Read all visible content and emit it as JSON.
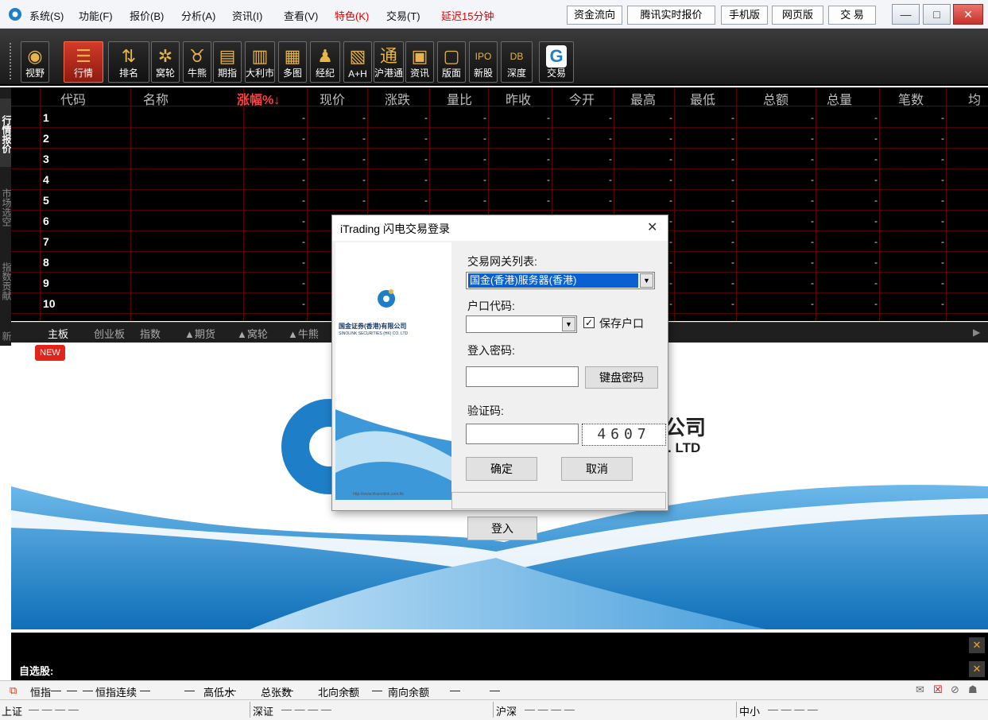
{
  "menubar": {
    "items": [
      "系统(S)",
      "功能(F)",
      "报价(B)",
      "分析(A)",
      "资讯(I)",
      "查看(V)",
      "特色(K)",
      "交易(T)"
    ],
    "delay_notice": "延迟15分钟",
    "buttons": [
      "资金流向",
      "腾讯实时报价",
      "手机版",
      "网页版",
      "交 易"
    ],
    "window_controls": {
      "minimize": "—",
      "maximize": "□",
      "close": "✕"
    }
  },
  "toolbar": {
    "items": [
      {
        "label": "视野",
        "icon": "eye-icon",
        "glyph": "◉"
      },
      {
        "label": "行情",
        "icon": "list-icon",
        "glyph": "☰"
      },
      {
        "label": "排名",
        "icon": "sort-icon",
        "glyph": "⇅"
      },
      {
        "label": "窝轮",
        "icon": "gear-icon",
        "glyph": "✲"
      },
      {
        "label": "牛熊",
        "icon": "bull-icon",
        "glyph": "♉"
      },
      {
        "label": "期指",
        "icon": "futures-chart-icon",
        "glyph": "▤"
      },
      {
        "label": "大利市",
        "icon": "market-chart-icon",
        "glyph": "▥"
      },
      {
        "label": "多图",
        "icon": "multi-chart-icon",
        "glyph": "▦"
      },
      {
        "label": "经纪",
        "icon": "broker-icon",
        "glyph": "♟"
      },
      {
        "label": "A+H",
        "icon": "ah-chart-icon",
        "glyph": "▧"
      },
      {
        "label": "沪港通",
        "icon": "connect-icon",
        "glyph": "通"
      },
      {
        "label": "资讯",
        "icon": "news-icon",
        "glyph": "▣"
      },
      {
        "label": "版面",
        "icon": "layout-icon",
        "glyph": "▢"
      },
      {
        "label": "新股",
        "icon": "ipo-icon",
        "glyph": "IPO"
      },
      {
        "label": "深度",
        "icon": "depth-icon",
        "glyph": "DB"
      },
      {
        "label": "交易",
        "icon": "trade-logo-icon",
        "glyph": "G"
      }
    ]
  },
  "quote_table": {
    "headers": [
      "代码",
      "名称",
      "涨幅%↓",
      "现价",
      "涨跌",
      "量比",
      "昨收",
      "今开",
      "最高",
      "最低",
      "总额",
      "总量",
      "笔数",
      "均"
    ],
    "rows": [
      "1",
      "2",
      "3",
      "4",
      "5",
      "6",
      "7",
      "8",
      "9",
      "10"
    ],
    "empty_value": "-"
  },
  "vertical_tabs": [
    "行情报价",
    "市场选空",
    "指数贡献",
    "新"
  ],
  "market_tabs": [
    "主板",
    "创业板",
    "指数",
    "▲期货",
    "▲窝轮",
    "▲牛熊"
  ],
  "banner": {
    "badge": "NEW",
    "company_text": "公司",
    "company_en": ". LTD",
    "login_button": "登入"
  },
  "dialog": {
    "title": "iTrading 闪电交易登录",
    "close": "✕",
    "gateway_label": "交易网关列表:",
    "gateway_value": "国金(香港)服务器(香港)",
    "account_label": "户口代码:",
    "save_account": "保存户口",
    "password_label": "登入密码:",
    "keyboard_button": "键盘密码",
    "captcha_label": "验证码:",
    "captcha_value": "4607",
    "ok_button": "确定",
    "cancel_button": "取消",
    "logo_cn": "国金证券(香港)有限公司",
    "logo_en": "SINOLINK SECURITIES (HK) CO. LTD",
    "website": "http://www.hksinolink.com.hk"
  },
  "bottom": {
    "zixuan_label": "自选股:",
    "status_row1": [
      "恒指",
      "—",
      "—",
      "—",
      "恒指连续",
      "—",
      "—",
      "高低水",
      "—",
      "总张数",
      "—",
      "北向余额",
      "—",
      "—",
      "南向余额",
      "—",
      "—"
    ],
    "status_row2": [
      {
        "label": "上证",
        "vals": "— — — —"
      },
      {
        "label": "深证",
        "vals": "— — — —"
      },
      {
        "label": "沪深",
        "vals": "— — — —"
      },
      {
        "label": "中小",
        "vals": "— — — —"
      }
    ],
    "close_glyph": "✕"
  },
  "colors": {
    "accent_red": "#e00000",
    "table_bg": "#000000",
    "header_gray": "#bcbcbc",
    "banner_blue": "#1e7fc8"
  }
}
